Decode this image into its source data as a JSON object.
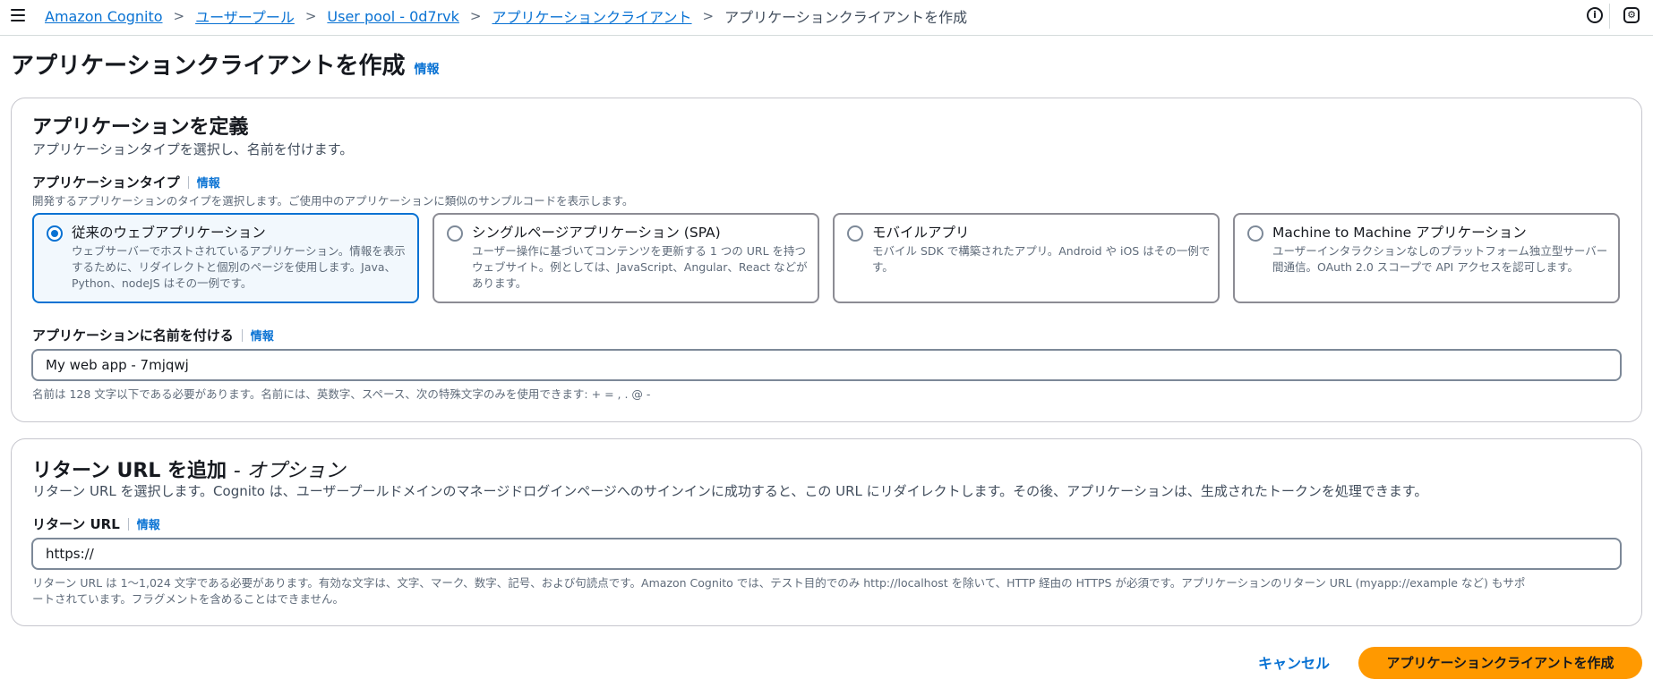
{
  "breadcrumb": {
    "items": [
      "Amazon Cognito",
      "ユーザープール",
      "User pool - 0d7rvk",
      "アプリケーションクライアント"
    ],
    "current": "アプリケーションクライアントを作成"
  },
  "icons": {
    "menu": "hamburger-icon",
    "info": "info-icon",
    "settings": "settings-icon"
  },
  "page": {
    "title": "アプリケーションクライアントを作成",
    "info_label": "情報"
  },
  "define_app": {
    "title": "アプリケーションを定義",
    "description": "アプリケーションタイプを選択し、名前を付けます。",
    "type_label": "アプリケーションタイプ",
    "type_info": "情報",
    "type_description": "開発するアプリケーションのタイプを選択します。ご使用中のアプリケーションに類似のサンプルコードを表示します。",
    "options": [
      {
        "title": "従来のウェブアプリケーション",
        "description": "ウェブサーバーでホストされているアプリケーション。情報を表示するために、リダイレクトと個別のページを使用します。Java、Python、nodeJS はその一例です。",
        "selected": true
      },
      {
        "title": "シングルページアプリケーション (SPA)",
        "description": "ユーザー操作に基づいてコンテンツを更新する 1 つの URL を持つウェブサイト。例としては、JavaScript、Angular、React などがあります。",
        "selected": false
      },
      {
        "title": "モバイルアプリ",
        "description": "モバイル SDK で構築されたアプリ。Android や iOS はその一例です。",
        "selected": false
      },
      {
        "title": "Machine to Machine アプリケーション",
        "description": "ユーザーインタラクションなしのプラットフォーム独立型サーバー間通信。OAuth 2.0 スコープで API アクセスを認可します。",
        "selected": false
      }
    ],
    "name_label": "アプリケーションに名前を付ける",
    "name_info": "情報",
    "name_value": "My web app - 7mjqwj",
    "name_hint": "名前は 128 文字以下である必要があります。名前には、英数字、スペース、次の特殊文字のみを使用できます: + = , . @ -"
  },
  "return_url": {
    "title": "リターン URL を追加",
    "title_optional": "- オプション",
    "description": "リターン URL を選択します。Cognito は、ユーザープールドメインのマネージドログインページへのサインインに成功すると、この URL にリダイレクトします。その後、アプリケーションは、生成されたトークンを処理できます。",
    "label": "リターン URL",
    "info": "情報",
    "value": "https://",
    "hint_line1": "リターン URL は 1〜1,024 文字である必要があります。有効な文字は、文字、マーク、数字、記号、および句読点です。Amazon Cognito では、テスト目的でのみ http://localhost を除いて、HTTP 経由の HTTPS が必須です。アプリケーションのリターン URL (myapp://example など) もサポ",
    "hint_line2": "ートされています。フラグメントを含めることはできません。"
  },
  "actions": {
    "cancel": "キャンセル",
    "create": "アプリケーションクライアントを作成"
  },
  "colors": {
    "link": "#0972d3",
    "primary_button": "#ff9900",
    "selected_border": "#0972d3"
  }
}
